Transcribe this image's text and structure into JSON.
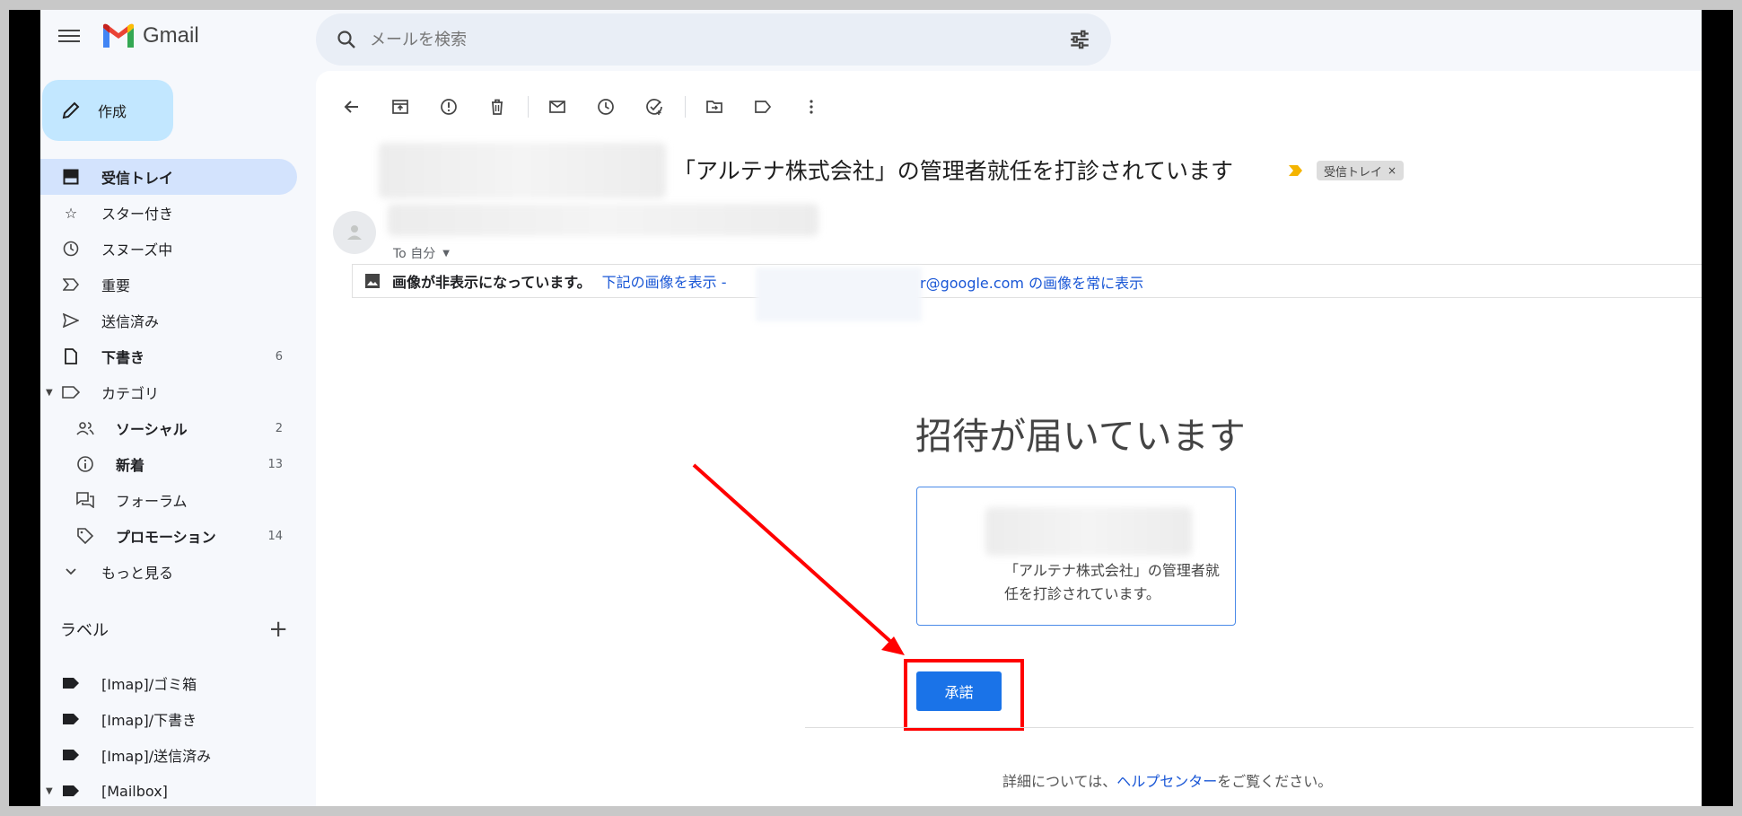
{
  "app": {
    "name": "Gmail"
  },
  "search": {
    "placeholder": "メールを検索"
  },
  "compose": {
    "label": "作成"
  },
  "nav": [
    {
      "label": "受信トレイ",
      "icon": "inbox-icon",
      "active": true
    },
    {
      "label": "スター付き",
      "icon": "star-icon"
    },
    {
      "label": "スヌーズ中",
      "icon": "clock-icon"
    },
    {
      "label": "重要",
      "icon": "important-icon"
    },
    {
      "label": "送信済み",
      "icon": "send-icon"
    },
    {
      "label": "下書き",
      "icon": "draft-icon",
      "count": "6",
      "bold": true
    },
    {
      "label": "カテゴリ",
      "icon": "label-icon",
      "expanded": true
    },
    {
      "label": "ソーシャル",
      "icon": "people-icon",
      "count": "2",
      "bold": true,
      "sub": true
    },
    {
      "label": "新着",
      "icon": "info-icon",
      "count": "13",
      "bold": true,
      "sub": true
    },
    {
      "label": "フォーラム",
      "icon": "forum-icon",
      "sub": true
    },
    {
      "label": "プロモーション",
      "icon": "tag-icon",
      "count": "14",
      "bold": true,
      "sub": true
    },
    {
      "label": "もっと見る",
      "icon": "chevron-down-icon"
    }
  ],
  "labels": {
    "heading": "ラベル",
    "add": "+",
    "items": [
      {
        "label": "[Imap]/ゴミ箱"
      },
      {
        "label": "[Imap]/下書き"
      },
      {
        "label": "[Imap]/送信済み"
      },
      {
        "label": "[Mailbox]",
        "expanded": true
      }
    ]
  },
  "email": {
    "subject": "「アルテナ株式会社」の管理者就任を打診されています",
    "chip": "受信トレイ",
    "chip_close": "×",
    "to": "To 自分",
    "image_notice": {
      "message": "画像が非表示になっています。",
      "link_show": "下記の画像を表示 -",
      "link_always": "r@google.com の画像を常に表示"
    },
    "invite_title": "招待が届いています",
    "card_text": "「アルテナ株式会社」の管理者就任を打診されています。",
    "accept": "承諾",
    "footer_pre": "詳細については、",
    "footer_link": "ヘルプセンター",
    "footer_post": "をご覧ください。"
  },
  "colors": {
    "accent": "#1a73e8",
    "highlight": "#ff0000",
    "compose": "#c2e7ff",
    "active_nav": "#d3e3fd"
  }
}
